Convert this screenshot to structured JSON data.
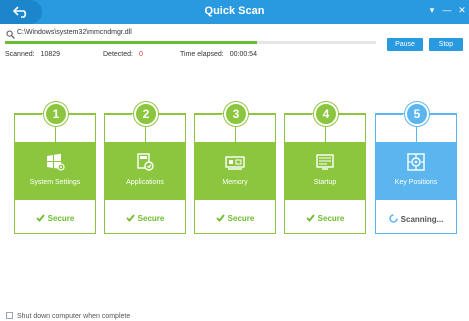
{
  "window": {
    "title": "Quick Scan",
    "controls": [
      "▾",
      "—",
      "✕"
    ]
  },
  "scan": {
    "current_file": "C:\\Windows\\system32\\mmcndmgr.dll",
    "progress": 0.68,
    "pause_label": "Pause",
    "stop_label": "Stop",
    "scanned_label": "Scanned:",
    "scanned_value": "10829",
    "detected_label": "Detected:",
    "detected_value": "0",
    "elapsed_label": "Time elapsed:",
    "elapsed_value": "00:00:54"
  },
  "steps": [
    {
      "number": "1",
      "name": "System Settings",
      "status": "Secure",
      "icon": "windows-settings-icon"
    },
    {
      "number": "2",
      "name": "Applications",
      "status": "Secure",
      "icon": "applications-icon"
    },
    {
      "number": "3",
      "name": "Memory",
      "status": "Secure",
      "icon": "memory-icon"
    },
    {
      "number": "4",
      "name": "Startup",
      "status": "Secure",
      "icon": "startup-icon"
    },
    {
      "number": "5",
      "name": "Key Positions",
      "status": "Scanning...",
      "icon": "key-positions-icon"
    }
  ],
  "colors": {
    "titlebar": "#2a9ae0",
    "done": "#8cc63f",
    "active": "#5bb6ef",
    "secure_text": "#6cbd2e",
    "detected": "#e23b3b"
  },
  "footer": {
    "shutdown_label": "Shut down computer when complete"
  }
}
